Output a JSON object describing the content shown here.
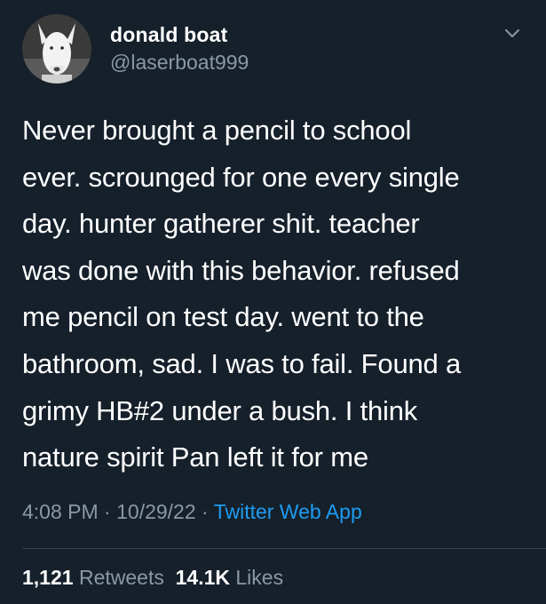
{
  "author": {
    "display_name": "donald boat",
    "handle": "@laserboat999",
    "avatar_icon": "bull-terrier-avatar"
  },
  "menu_icon": "chevron-down-icon",
  "tweet": {
    "text": "Never brought a pencil to school\never. scrounged for one every single\nday. hunter gatherer shit. teacher\nwas done with this behavior. refused\nme pencil on test day. went to the\nbathroom, sad. I was to fail. Found a\ngrimy HB#2 under a bush. I think\nnature spirit Pan left it for me"
  },
  "meta": {
    "time": "4:08 PM",
    "separator": "·",
    "date": "10/29/22",
    "source": "Twitter Web App"
  },
  "stats": {
    "retweets_count": "1,121",
    "retweets_label": "Retweets",
    "likes_count": "14.1K",
    "likes_label": "Likes"
  },
  "colors": {
    "background": "#15202b",
    "text": "#ffffff",
    "secondary": "#8b98a5",
    "link": "#1d9bf0"
  }
}
